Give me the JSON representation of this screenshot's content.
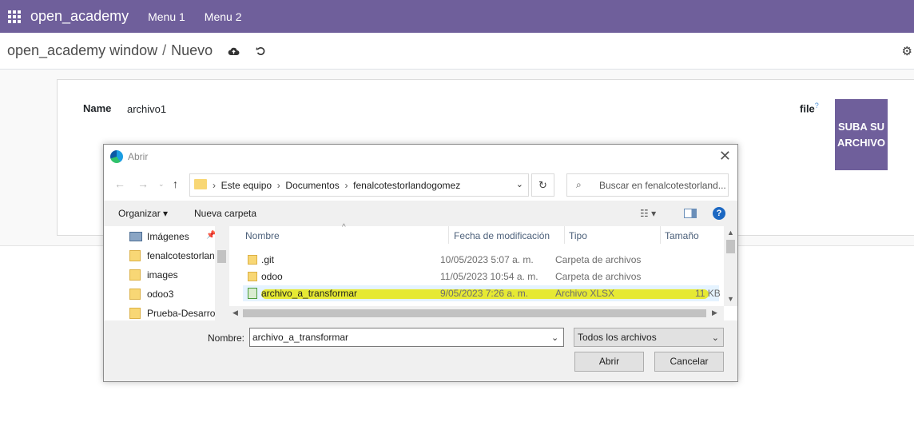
{
  "navbar": {
    "brand": "open_academy",
    "menu": [
      "Menu 1",
      "Menu 2"
    ]
  },
  "control": {
    "breadcrumb_parent": "open_academy window",
    "breadcrumb_sep": "/",
    "breadcrumb_current": "Nuevo"
  },
  "form": {
    "name_label": "Name",
    "name_value": "archivo1",
    "file_label": "file",
    "file_help": "?",
    "upload_button": "SUBA SU ARCHIVO"
  },
  "dialog": {
    "title": "Abrir",
    "path": [
      "Este equipo",
      "Documentos",
      "fenalcotestorlandogomez"
    ],
    "search_placeholder": "Buscar en fenalcotestorland...",
    "organize": "Organizar",
    "new_folder": "Nueva carpeta",
    "tree": [
      {
        "label": "Imágenes",
        "type": "images",
        "pinned": true
      },
      {
        "label": "fenalcotestorlan",
        "type": "folder"
      },
      {
        "label": "images",
        "type": "folder"
      },
      {
        "label": "odoo3",
        "type": "folder"
      },
      {
        "label": "Prueba-Desarrol",
        "type": "folder"
      }
    ],
    "columns": [
      "Nombre",
      "Fecha de modificación",
      "Tipo",
      "Tamaño"
    ],
    "files": [
      {
        "name": ".git",
        "date": "10/05/2023 5:07 a. m.",
        "type": "Carpeta de archivos",
        "size": "",
        "kind": "folder"
      },
      {
        "name": "odoo",
        "date": "11/05/2023 10:54 a. m.",
        "type": "Carpeta de archivos",
        "size": "",
        "kind": "folder"
      },
      {
        "name": "archivo_a_transformar",
        "date": "9/05/2023 7:26 a. m.",
        "type": "Archivo XLSX",
        "size": "11 KB",
        "kind": "xlsx",
        "selected": true
      }
    ],
    "filename_label": "Nombre:",
    "filename_value": "archivo_a_transformar",
    "filter_value": "Todos los archivos",
    "open_button": "Abrir",
    "cancel_button": "Cancelar"
  },
  "colors": {
    "brand": "#6f5f9b",
    "highlight": "#e6e600",
    "folder": "#f8d775"
  }
}
